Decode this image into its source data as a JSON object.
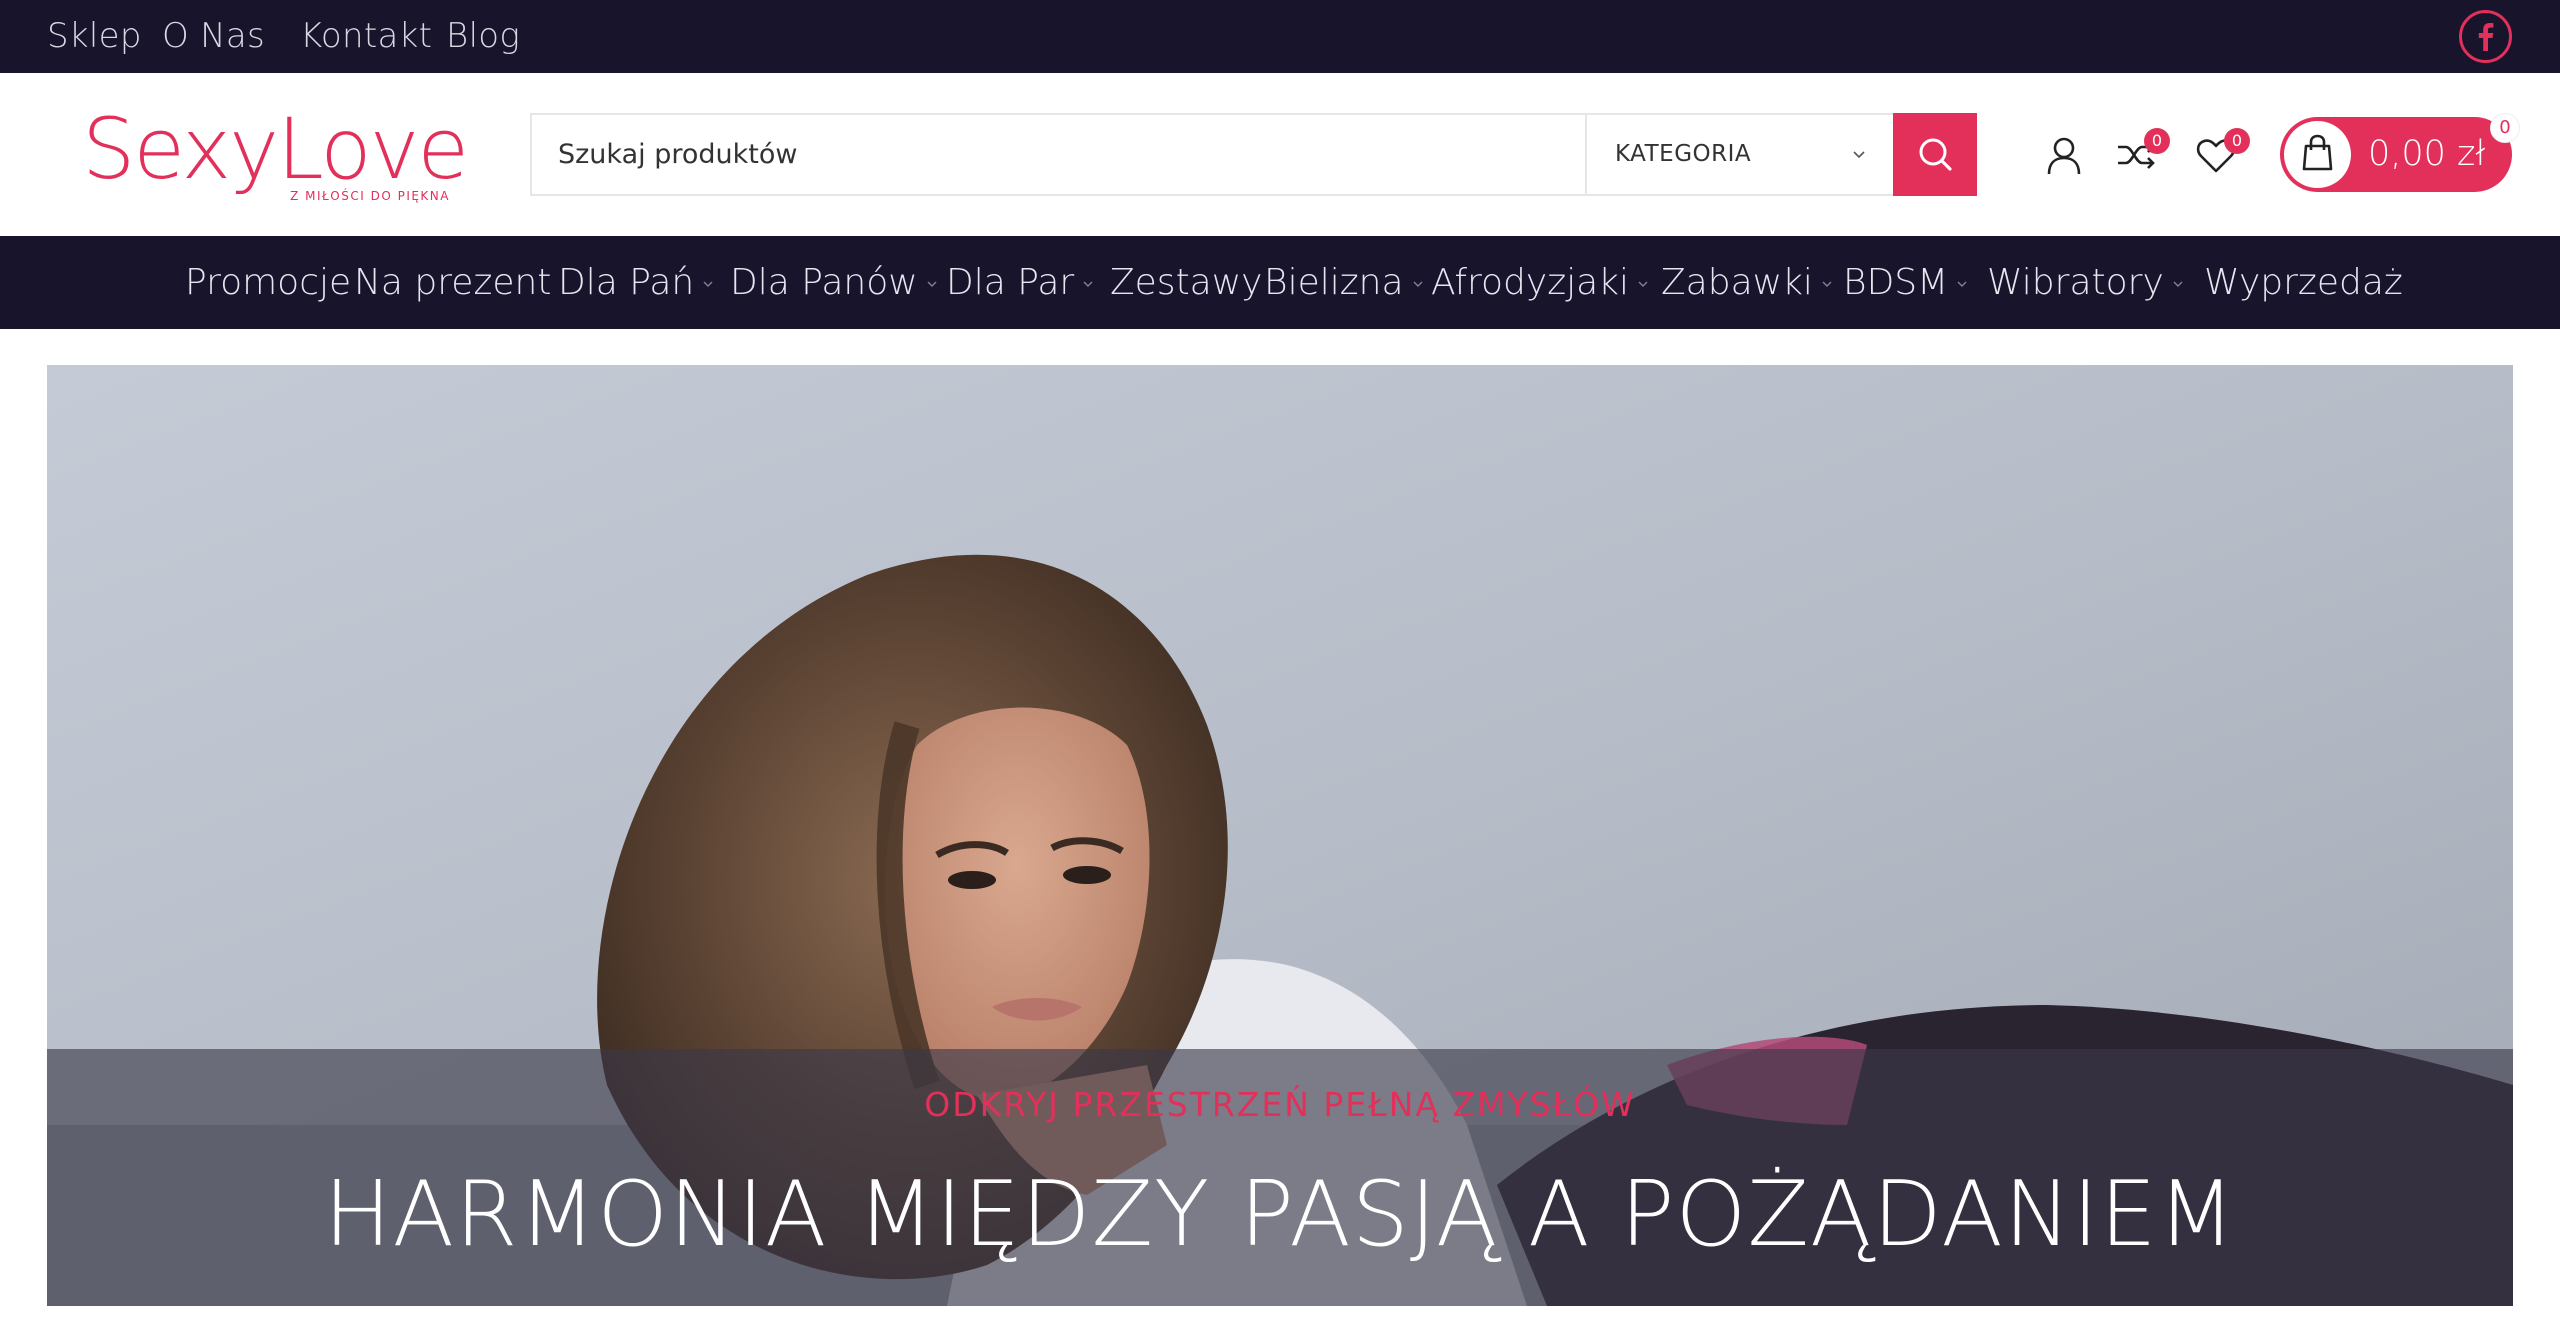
{
  "topbar": {
    "links": [
      "Sklep",
      "O Nas",
      "Kontakt",
      "Blog"
    ],
    "facebook_icon": "facebook-icon"
  },
  "logo": {
    "brand": "SexyLove",
    "tagline": "Z MIŁOŚCI DO PIĘKNA"
  },
  "search": {
    "placeholder": "Szukaj produktów",
    "category_label": "KATEGORIA",
    "button_icon": "search-icon"
  },
  "header_icons": {
    "account_icon": "user-icon",
    "compare_count": "0",
    "wishlist_count": "0"
  },
  "cart": {
    "total": "0,00 zł",
    "count": "0"
  },
  "nav": {
    "items": [
      {
        "label": "Promocje",
        "dropdown": false
      },
      {
        "label": "Na prezent",
        "dropdown": false
      },
      {
        "label": "Dla Pań",
        "dropdown": true
      },
      {
        "label": "Dla Panów",
        "dropdown": true
      },
      {
        "label": "Dla Par",
        "dropdown": true
      },
      {
        "label": "Zestawy",
        "dropdown": false
      },
      {
        "label": "Bielizna",
        "dropdown": true
      },
      {
        "label": "Afrodyzjaki",
        "dropdown": true
      },
      {
        "label": "Zabawki",
        "dropdown": true
      },
      {
        "label": "BDSM",
        "dropdown": true
      },
      {
        "label": "Wibratory",
        "dropdown": true
      },
      {
        "label": "Wyprzedaż",
        "dropdown": false
      }
    ]
  },
  "hero": {
    "kicker": "ODKRYJ PRZESTRZEŃ PEŁNĄ ZMYSŁÓW",
    "title": "HARMONIA MIĘDZY PASJĄ A POŻĄDANIEM"
  },
  "colors": {
    "accent": "#e2305a",
    "dark": "#17142c"
  }
}
